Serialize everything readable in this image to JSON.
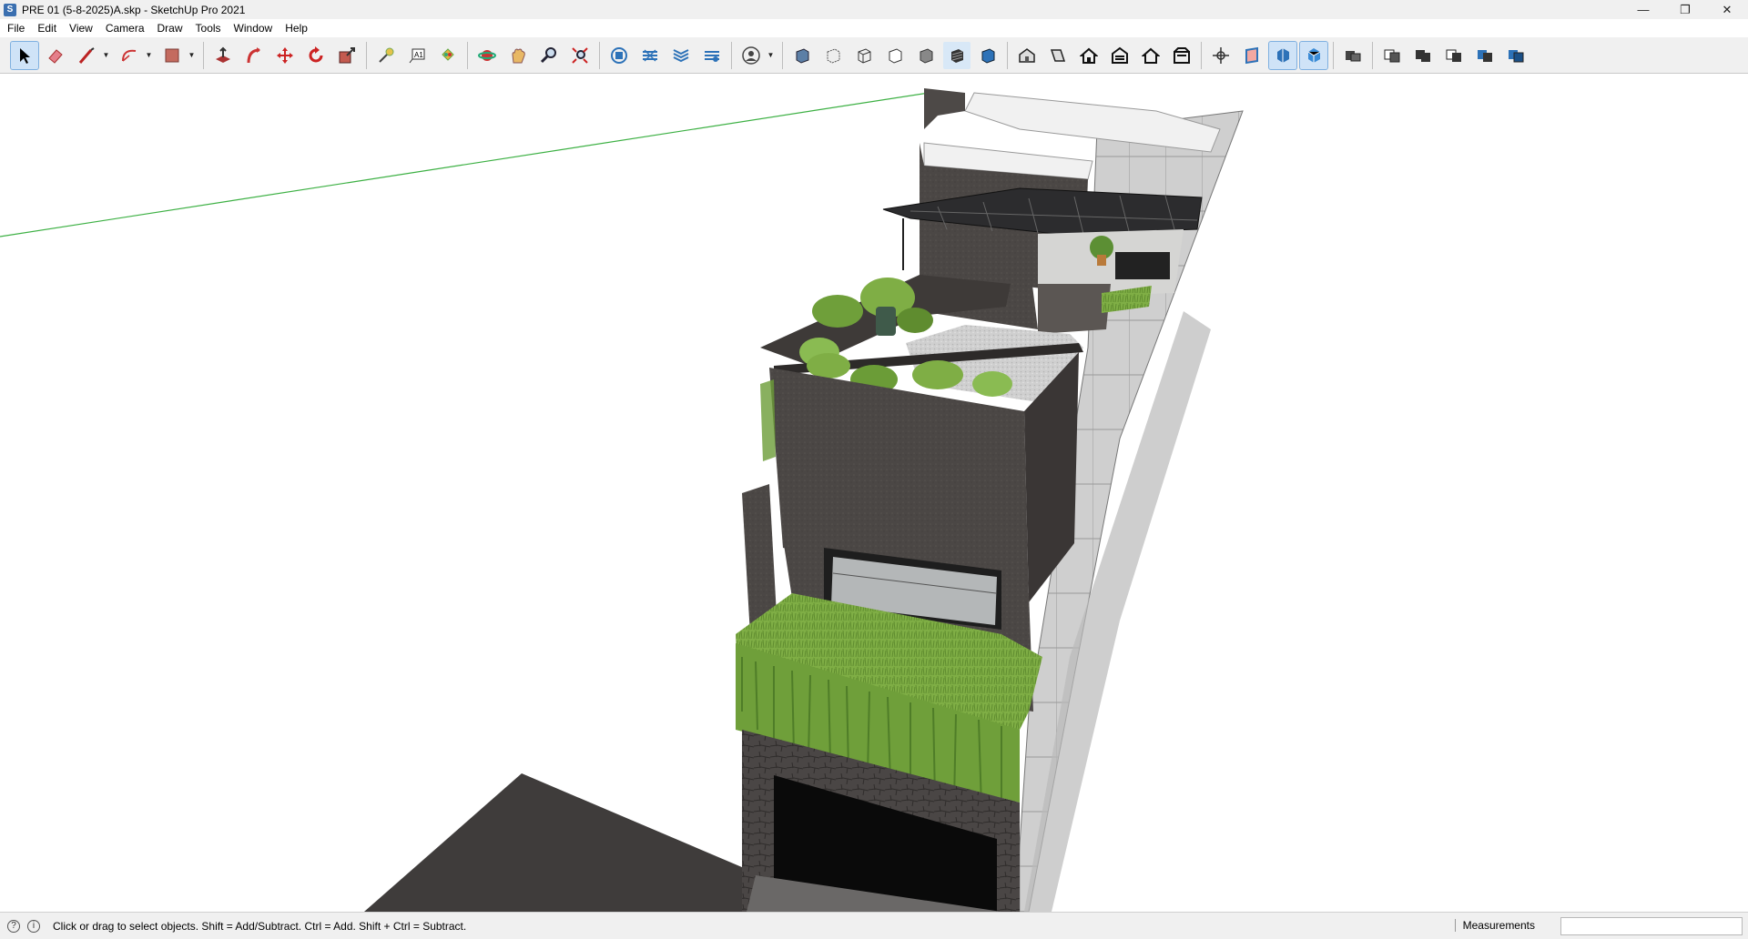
{
  "window": {
    "title": "PRE 01 (5-8-2025)A.skp - SketchUp Pro 2021",
    "controls": [
      "minimize-icon",
      "restore-icon",
      "close-icon"
    ]
  },
  "menu": [
    "File",
    "Edit",
    "View",
    "Camera",
    "Draw",
    "Tools",
    "Window",
    "Help"
  ],
  "toolbar": {
    "groups": [
      [
        "select-icon",
        "eraser-icon",
        "line-icon",
        "arc-icon",
        "rectangle-icon"
      ],
      [
        "push-pull-icon",
        "follow-me-icon",
        "move-icon",
        "rotate-icon",
        "scale-icon"
      ],
      [
        "tape-measure-icon",
        "text-icon",
        "paint-bucket-icon"
      ],
      [
        "orbit-icon",
        "pan-icon",
        "zoom-icon",
        "zoom-extents-icon"
      ],
      [
        "3d-warehouse-icon",
        "extension-warehouse-icon",
        "layout-icon",
        "extension-manager-icon"
      ],
      [
        "account-icon"
      ],
      [
        "xray-icon",
        "back-edges-icon",
        "wireframe-icon",
        "hidden-line-icon",
        "shaded-icon",
        "shaded-textures-icon",
        "monochrome-icon"
      ],
      [
        "iso-view-icon",
        "top-view-icon",
        "front-view-icon",
        "right-view-icon",
        "back-view-icon",
        "left-view-icon"
      ],
      [
        "section-plane-icon",
        "display-section-planes-icon",
        "display-section-cuts-icon",
        "display-section-fill-icon"
      ],
      [
        "outer-shell-icon"
      ],
      [
        "intersect-icon",
        "union-icon",
        "subtract-icon",
        "trim-icon",
        "split-icon"
      ]
    ],
    "active": "select-icon"
  },
  "status": {
    "message": "Click or drag to select objects. Shift = Add/Subtract. Ctrl = Add. Shift + Ctrl = Subtract.",
    "measurements_label": "Measurements",
    "measurements_value": ""
  },
  "colors": {
    "accent": "#3a6fb0",
    "axis_green": "#3cb043",
    "building_dark": "#4a4644",
    "grass": "#7fae45"
  }
}
